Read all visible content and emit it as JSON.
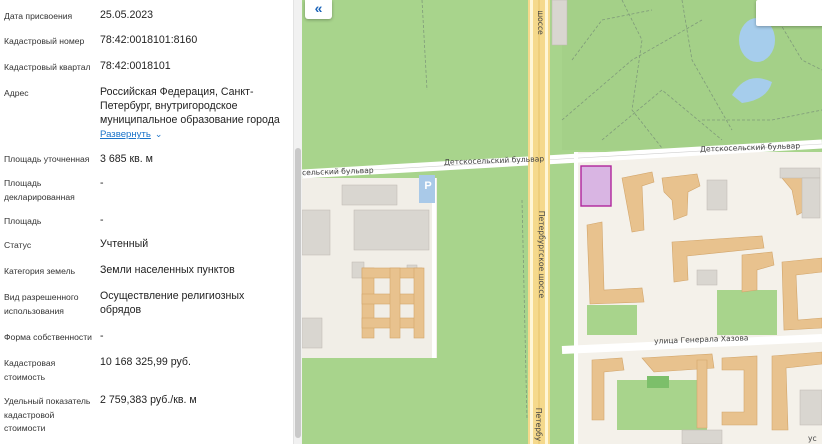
{
  "details": [
    {
      "label": "Дата присвоения",
      "value": "25.05.2023"
    },
    {
      "label": "Кадастровый номер",
      "value": "78:42:0018101:8160"
    },
    {
      "label": "Кадастровый квартал",
      "value": "78:42:0018101"
    },
    {
      "label": "Адрес",
      "value": "Российская Федерация, Санкт-Петербург, внутригородское муниципальное образование города"
    },
    {
      "label": "Площадь уточненная",
      "value": "3 685 кв. м"
    },
    {
      "label": "Площадь декларированная",
      "value": "-"
    },
    {
      "label": "Площадь",
      "value": "-"
    },
    {
      "label": "Статус",
      "value": "Учтенный"
    },
    {
      "label": "Категория земель",
      "value": "Земли населенных пунктов"
    },
    {
      "label": "Вид разрешенного использования",
      "value": "Осуществление религиозных обрядов"
    },
    {
      "label": "Форма собственности",
      "value": "-"
    },
    {
      "label": "Кадастровая стоимость",
      "value": "10 168 325,99 руб."
    },
    {
      "label": "Удельный показатель кадастровой стоимости",
      "value": "2 759,383 руб./кв. м"
    }
  ],
  "address_expand_label": "Развернуть",
  "map": {
    "collapse_icon": "«",
    "parking_label": "P",
    "streets": {
      "bulvar_left": "сельский бульвар",
      "bulvar_center": "Детскосельский бульвар",
      "bulvar_right": "Детскосельский бульвар",
      "shosse_top": "шоссе",
      "shosse_mid": "Петербургское шоссе",
      "shosse_bottom": "Петербу",
      "generala": "улица Генерала Хазова",
      "us": "ус"
    }
  },
  "colors": {
    "park": "#a8d48c",
    "road": "#f5d98c",
    "building": "#e8c28e",
    "parcel_border": "#b0259c",
    "parcel_fill": "#d9b5e3",
    "link": "#1a73c9"
  }
}
